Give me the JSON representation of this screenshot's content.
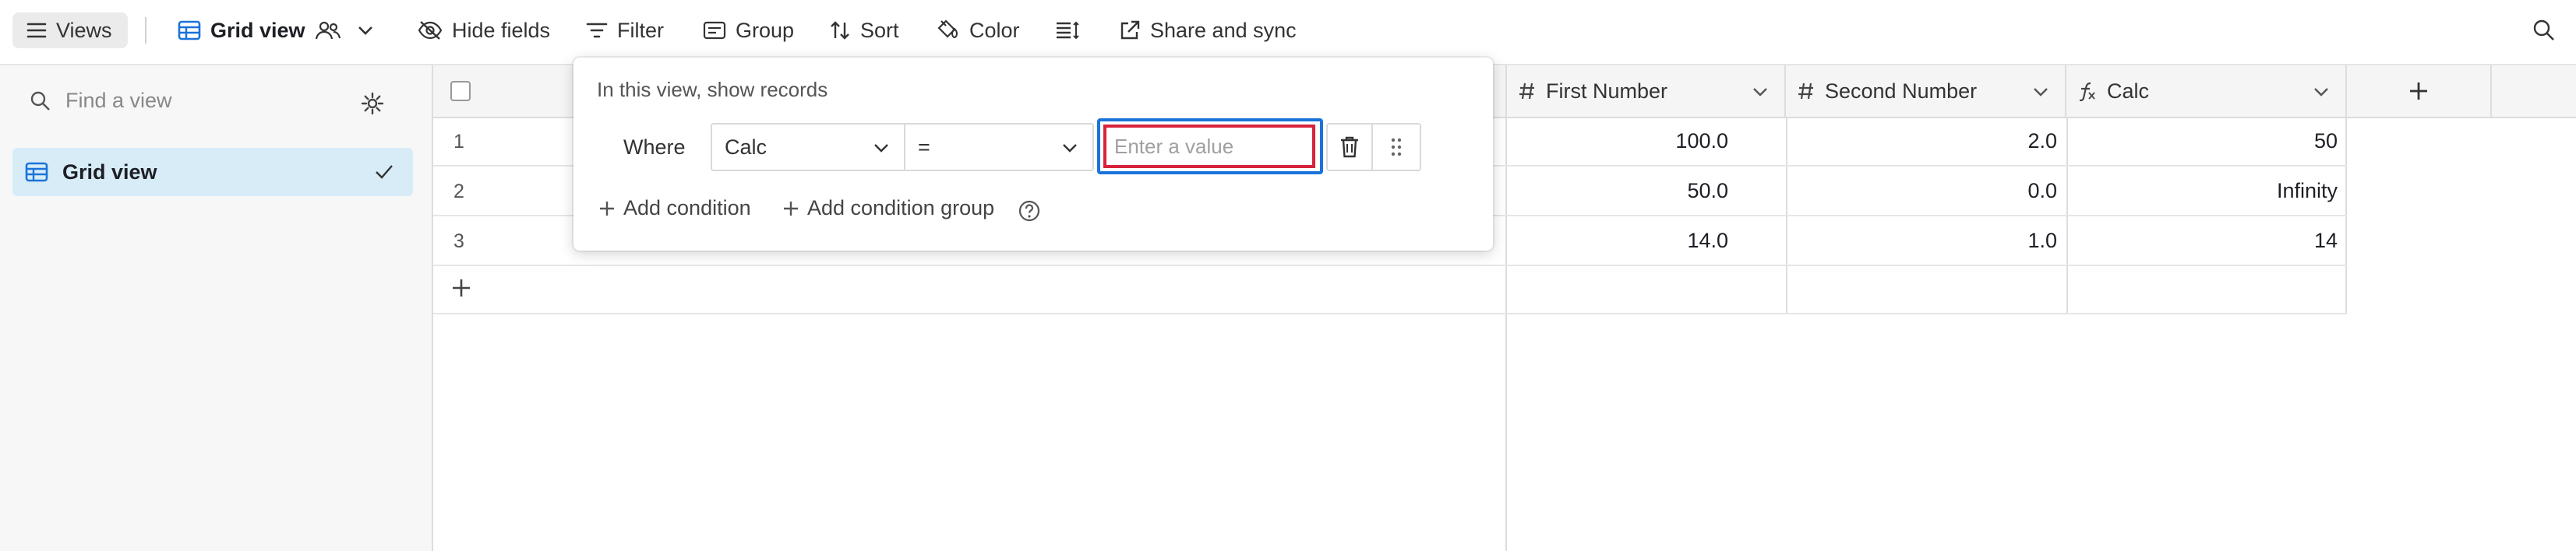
{
  "toolbar": {
    "views_label": "Views",
    "view_name": "Grid view",
    "hide_fields_label": "Hide fields",
    "filter_label": "Filter",
    "group_label": "Group",
    "sort_label": "Sort",
    "color_label": "Color",
    "share_label": "Share and sync"
  },
  "sidebar": {
    "search_placeholder": "Find a view",
    "items": [
      {
        "label": "Grid view",
        "selected": true
      }
    ]
  },
  "grid": {
    "columns": [
      {
        "label": "First Number",
        "icon": "number-icon"
      },
      {
        "label": "Second Number",
        "icon": "number-icon"
      },
      {
        "label": "Calc",
        "icon": "formula-icon"
      }
    ],
    "rows": [
      {
        "num": "1",
        "first": "100.0",
        "second": "2.0",
        "calc": "50"
      },
      {
        "num": "2",
        "first": "50.0",
        "second": "0.0",
        "calc": "Infinity"
      },
      {
        "num": "3",
        "first": "14.0",
        "second": "1.0",
        "calc": "14"
      }
    ]
  },
  "filter_popover": {
    "title": "In this view, show records",
    "where_label": "Where",
    "field_value": "Calc",
    "operator_value": "=",
    "value_placeholder": "Enter a value",
    "add_condition_label": "Add condition",
    "add_group_label": "Add condition group"
  },
  "colors": {
    "accent_blue": "#1a73d9",
    "error_red": "#d9233b",
    "selected_bg": "#d7ecf7"
  }
}
